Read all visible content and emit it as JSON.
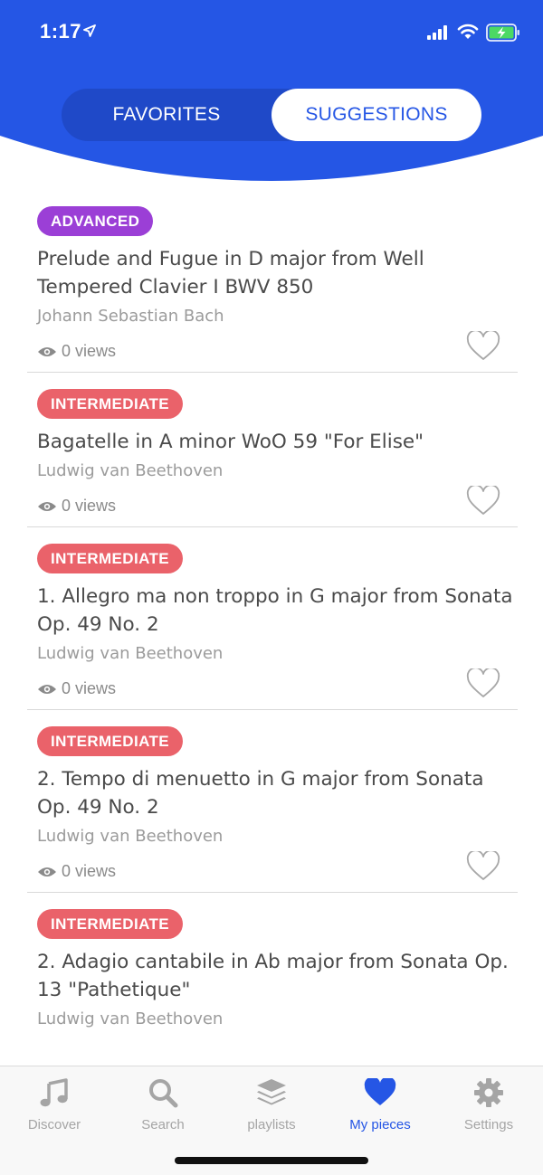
{
  "status_bar": {
    "time": "1:17"
  },
  "segment": {
    "favorites": "FAVORITES",
    "suggestions": "SUGGESTIONS"
  },
  "colors": {
    "header_blue": "#2556e5",
    "advanced": "#9b3fd6",
    "intermediate": "#ea626a"
  },
  "pieces": [
    {
      "level": "ADVANCED",
      "title": "Prelude and Fugue in D major from Well Tempered Clavier I BWV 850",
      "composer": "Johann Sebastian Bach",
      "views": "0 views"
    },
    {
      "level": "INTERMEDIATE",
      "title": "Bagatelle in A minor WoO 59 \"For Elise\"",
      "composer": "Ludwig van Beethoven",
      "views": "0 views"
    },
    {
      "level": "INTERMEDIATE",
      "title": "1. Allegro ma non troppo in G major from Sonata Op. 49 No. 2",
      "composer": "Ludwig van Beethoven",
      "views": "0 views"
    },
    {
      "level": "INTERMEDIATE",
      "title": "2. Tempo di menuetto in G major from Sonata Op. 49 No. 2",
      "composer": "Ludwig van Beethoven",
      "views": "0 views"
    },
    {
      "level": "INTERMEDIATE",
      "title": "2. Adagio cantabile in Ab major from Sonata Op. 13 \"Pathetique\"",
      "composer": "Ludwig van Beethoven",
      "views": "0 views"
    }
  ],
  "tabs": [
    {
      "label": "Discover",
      "icon": "music-note-icon"
    },
    {
      "label": "Search",
      "icon": "search-icon"
    },
    {
      "label": "playlists",
      "icon": "layers-icon"
    },
    {
      "label": "My pieces",
      "icon": "heart-icon"
    },
    {
      "label": "Settings",
      "icon": "gear-icon"
    }
  ]
}
